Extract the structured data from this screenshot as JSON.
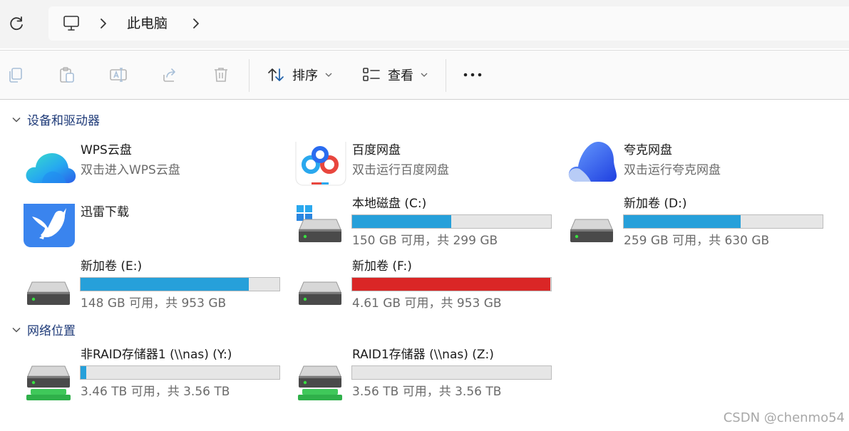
{
  "address": {
    "refresh_icon": "refresh-icon",
    "location_icon": "computer-monitor-icon",
    "breadcrumb": "此电脑"
  },
  "toolbar": {
    "sort_label": "排序",
    "view_label": "查看"
  },
  "sections": {
    "devices": "设备和驱动器",
    "network": "网络位置"
  },
  "apps": {
    "wps": {
      "name": "WPS云盘",
      "sub": "双击进入WPS云盘"
    },
    "baidu": {
      "name": "百度网盘",
      "sub": "双击运行百度网盘"
    },
    "quark": {
      "name": "夸克网盘",
      "sub": "双击运行夸克网盘"
    },
    "xunlei": {
      "name": "迅雷下载"
    }
  },
  "drives": {
    "c": {
      "name": "本地磁盘 (C:)",
      "usage": "150 GB 可用，共 299 GB",
      "used_fraction": 0.498,
      "color": "#26a0da"
    },
    "d": {
      "name": "新加卷 (D:)",
      "usage": "259 GB 可用，共 630 GB",
      "used_fraction": 0.589,
      "color": "#26a0da"
    },
    "e": {
      "name": "新加卷 (E:)",
      "usage": "148 GB 可用，共 953 GB",
      "used_fraction": 0.845,
      "color": "#26a0da"
    },
    "f": {
      "name": "新加卷 (F:)",
      "usage": "4.61 GB 可用，共 953 GB",
      "used_fraction": 0.995,
      "color": "#da2626"
    },
    "y": {
      "name": "非RAID存储器1 (\\\\nas) (Y:)",
      "usage": "3.46 TB 可用，共 3.56 TB",
      "used_fraction": 0.028,
      "color": "#26a0da"
    },
    "z": {
      "name": "RAID1存储器 (\\\\nas) (Z:)",
      "usage": "3.56 TB 可用，共 3.56 TB",
      "used_fraction": 0.0,
      "color": "#26a0da"
    }
  },
  "watermark": "CSDN @chenmo54"
}
